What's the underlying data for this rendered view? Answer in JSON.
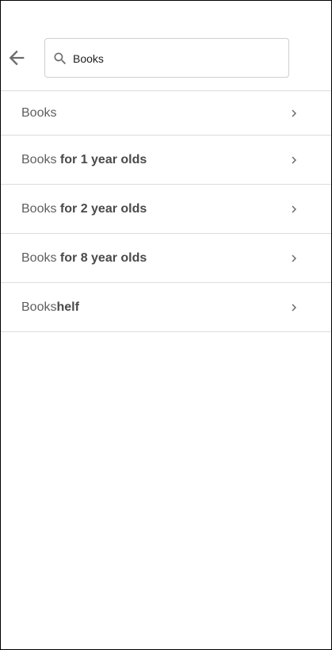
{
  "header": {
    "back_icon": "arrow-back-icon",
    "search": {
      "icon": "search-icon",
      "value": "Books",
      "placeholder": ""
    }
  },
  "suggestions": [
    {
      "prefix": "Books",
      "suffix": ""
    },
    {
      "prefix": "Books",
      "suffix": " for 1 year olds"
    },
    {
      "prefix": "Books",
      "suffix": " for 2 year olds"
    },
    {
      "prefix": "Books",
      "suffix": " for 8 year olds"
    },
    {
      "prefix": "Books",
      "suffix": "helf"
    }
  ],
  "colors": {
    "icon": "#6b6b6b",
    "divider": "#dcdcdc",
    "text": "#5f5f5f"
  }
}
